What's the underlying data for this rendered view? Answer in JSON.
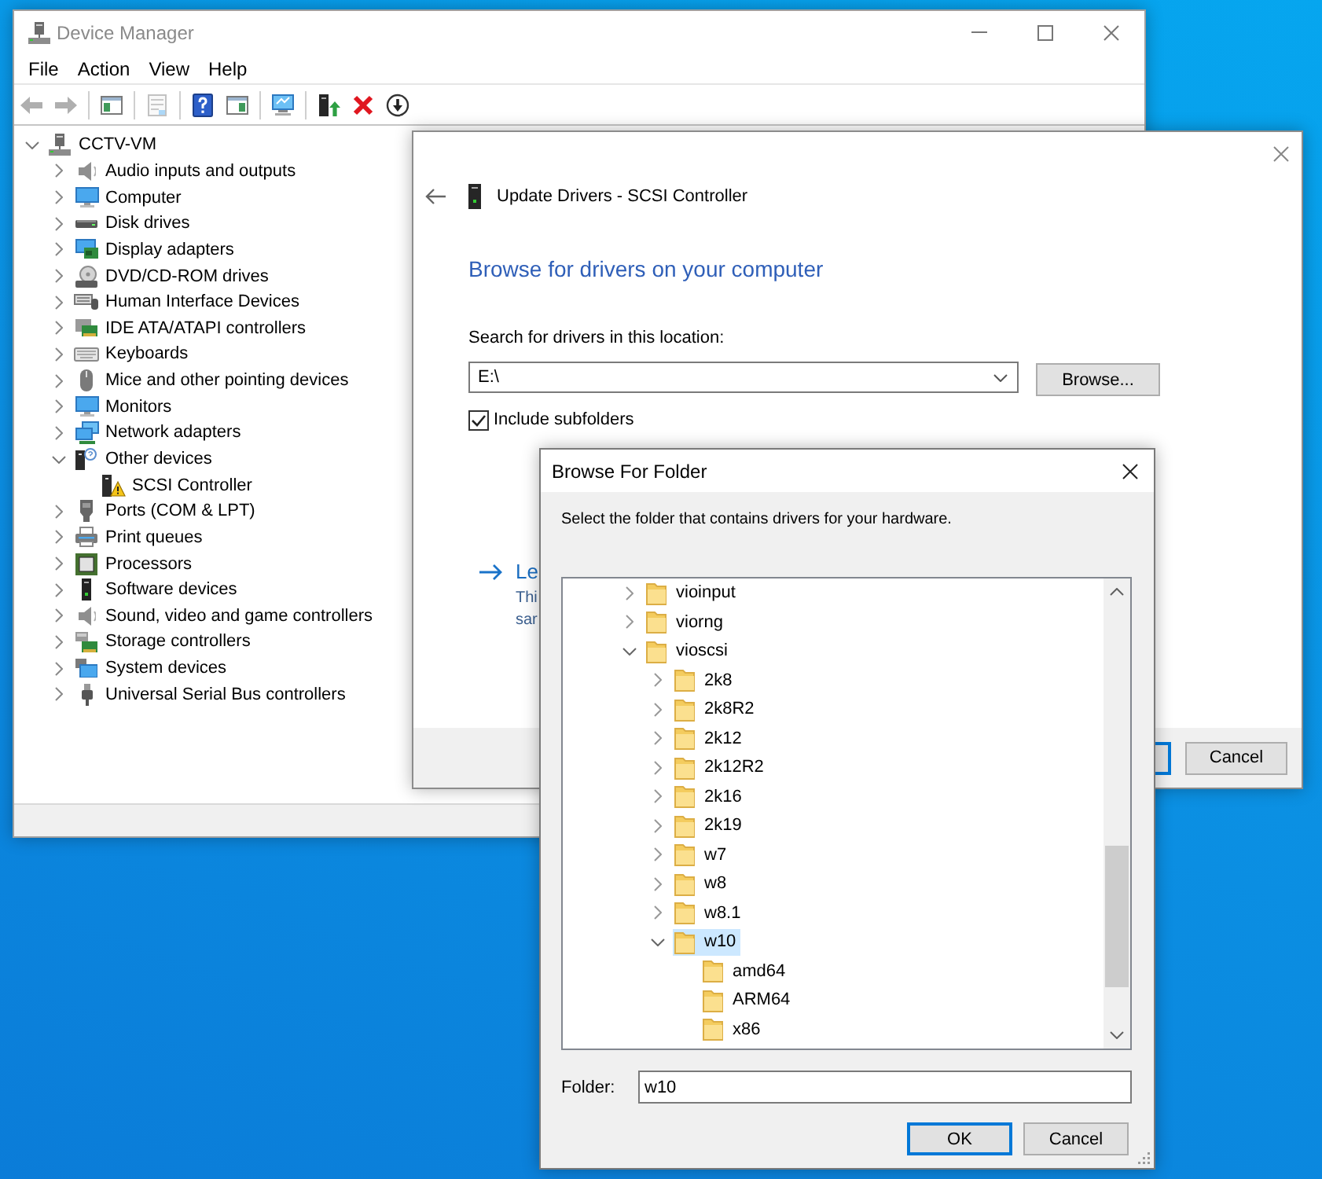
{
  "device_manager": {
    "title": "Device Manager",
    "menu": [
      "File",
      "Action",
      "View",
      "Help"
    ],
    "toolbar": [
      {
        "kind": "back",
        "disabled": true
      },
      {
        "kind": "forward",
        "disabled": true
      },
      {
        "kind": "separator"
      },
      {
        "kind": "console_tree",
        "disabled": false
      },
      {
        "kind": "separator"
      },
      {
        "kind": "properties",
        "disabled": true
      },
      {
        "kind": "separator"
      },
      {
        "kind": "help",
        "disabled": false
      },
      {
        "kind": "action_pane",
        "disabled": false
      },
      {
        "kind": "separator"
      },
      {
        "kind": "scan",
        "disabled": false
      },
      {
        "kind": "separator"
      },
      {
        "kind": "update_driver",
        "disabled": false
      },
      {
        "kind": "uninstall",
        "disabled": false
      },
      {
        "kind": "disable_device",
        "disabled": false
      }
    ],
    "tree": {
      "label": "CCTV-VM",
      "kind": "host",
      "expanded": true,
      "children": [
        {
          "label": "Audio inputs and outputs",
          "kind": "audio",
          "expanded": false
        },
        {
          "label": "Computer",
          "kind": "computer",
          "expanded": false
        },
        {
          "label": "Disk drives",
          "kind": "disk",
          "expanded": false
        },
        {
          "label": "Display adapters",
          "kind": "display",
          "expanded": false
        },
        {
          "label": "DVD/CD-ROM drives",
          "kind": "dvd",
          "expanded": false
        },
        {
          "label": "Human Interface Devices",
          "kind": "hid",
          "expanded": false
        },
        {
          "label": "IDE ATA/ATAPI controllers",
          "kind": "ide",
          "expanded": false
        },
        {
          "label": "Keyboards",
          "kind": "keyboard",
          "expanded": false
        },
        {
          "label": "Mice and other pointing devices",
          "kind": "mouse",
          "expanded": false
        },
        {
          "label": "Monitors",
          "kind": "monitor",
          "expanded": false
        },
        {
          "label": "Network adapters",
          "kind": "network",
          "expanded": false
        },
        {
          "label": "Other devices",
          "kind": "other",
          "expanded": true,
          "children": [
            {
              "label": "SCSI Controller",
              "kind": "warning"
            }
          ]
        },
        {
          "label": "Ports (COM & LPT)",
          "kind": "ports",
          "expanded": false
        },
        {
          "label": "Print queues",
          "kind": "printer",
          "expanded": false
        },
        {
          "label": "Processors",
          "kind": "processor",
          "expanded": false
        },
        {
          "label": "Software devices",
          "kind": "software",
          "expanded": false
        },
        {
          "label": "Sound, video and game controllers",
          "kind": "sound",
          "expanded": false
        },
        {
          "label": "Storage controllers",
          "kind": "storage",
          "expanded": false
        },
        {
          "label": "System devices",
          "kind": "system",
          "expanded": false
        },
        {
          "label": "Universal Serial Bus controllers",
          "kind": "usb",
          "expanded": false
        }
      ]
    }
  },
  "update_drivers": {
    "title": "Update Drivers - SCSI Controller",
    "heading": "Browse for drivers on your computer",
    "location_label": "Search for drivers in this location:",
    "location_value": "E:\\",
    "browse_button": "Browse...",
    "include_subfolders": {
      "label": "Include subfolders",
      "checked": true
    },
    "link_fragment": "Le",
    "description_fragments": [
      "Thi",
      "sar"
    ],
    "covered_button": {
      "focused": true
    },
    "cancel_button": "Cancel"
  },
  "browse_folder": {
    "title": "Browse For Folder",
    "instruction": "Select the folder that contains drivers for your hardware.",
    "tree": [
      {
        "label": "vioinput",
        "expanded": false,
        "selected": false
      },
      {
        "label": "viorng",
        "expanded": false,
        "selected": false
      },
      {
        "label": "vioscsi",
        "expanded": true,
        "selected": false,
        "children": [
          {
            "label": "2k8",
            "expanded": false,
            "selected": false
          },
          {
            "label": "2k8R2",
            "expanded": false,
            "selected": false
          },
          {
            "label": "2k12",
            "expanded": false,
            "selected": false
          },
          {
            "label": "2k12R2",
            "expanded": false,
            "selected": false
          },
          {
            "label": "2k16",
            "expanded": false,
            "selected": false
          },
          {
            "label": "2k19",
            "expanded": false,
            "selected": false
          },
          {
            "label": "w7",
            "expanded": false,
            "selected": false
          },
          {
            "label": "w8",
            "expanded": false,
            "selected": false
          },
          {
            "label": "w8.1",
            "expanded": false,
            "selected": false
          },
          {
            "label": "w10",
            "expanded": true,
            "selected": true,
            "children": [
              {
                "label": "amd64",
                "selected": false
              },
              {
                "label": "ARM64",
                "selected": false
              },
              {
                "label": "x86",
                "selected": false
              }
            ]
          }
        ]
      }
    ],
    "folder_label": "Folder:",
    "folder_value": "w10",
    "buttons": [
      {
        "label": "OK",
        "focused": true
      },
      {
        "label": "Cancel",
        "focused": false
      }
    ]
  }
}
